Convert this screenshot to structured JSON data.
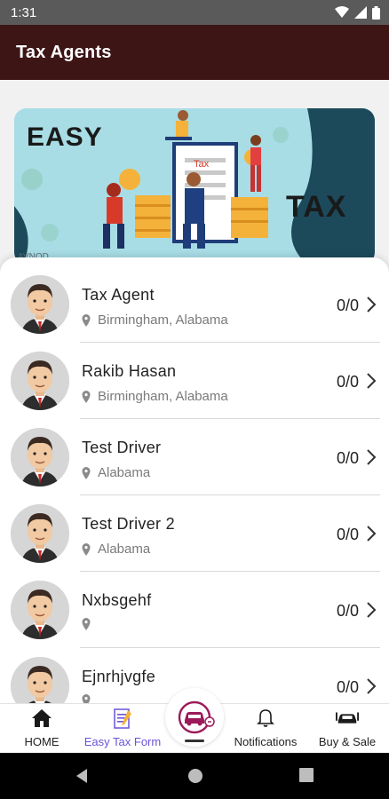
{
  "status_bar": {
    "time": "1:31"
  },
  "app_bar": {
    "title": "Tax Agents"
  },
  "banner": {
    "text_easy": "EASY",
    "text_tax": "TAX",
    "paper_label": "Tax",
    "watermark": "AVNOD"
  },
  "agents": [
    {
      "name": "Tax Agent",
      "location": "Birmingham,  Alabama",
      "count": "0/0"
    },
    {
      "name": "Rakib Hasan",
      "location": "Birmingham,  Alabama",
      "count": "0/0"
    },
    {
      "name": "Test Driver",
      "location": " Alabama",
      "count": "0/0"
    },
    {
      "name": "Test Driver 2",
      "location": " Alabama",
      "count": "0/0"
    },
    {
      "name": "Nxbsgehf",
      "location": "",
      "count": "0/0"
    },
    {
      "name": "Ejnrhjvgfe",
      "location": "",
      "count": "0/0"
    }
  ],
  "bottom_nav": {
    "home": "HOME",
    "easy_tax_form": "Easy Tax Form",
    "notifications": "Notifications",
    "buy_sale": "Buy & Sale"
  },
  "colors": {
    "app_bar": "#3d1515",
    "accent": "#6c52d8",
    "fab_car": "#9c1a5a"
  }
}
